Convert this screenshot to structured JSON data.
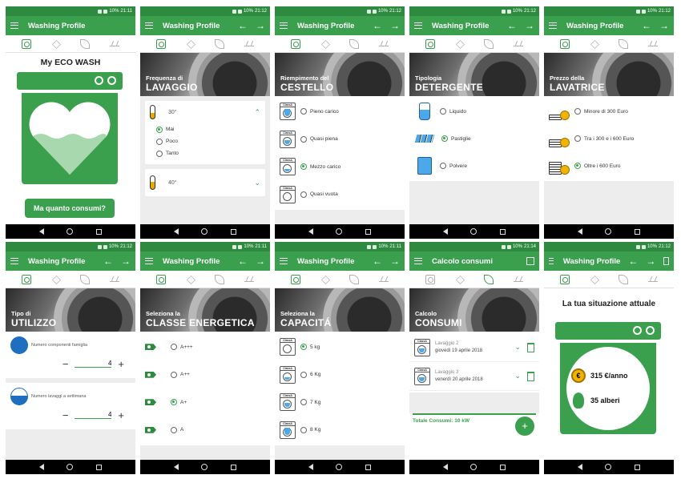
{
  "status_time": [
    "21:11",
    "21:12",
    "21:12",
    "21:12",
    "21:12",
    "21:12",
    "21:11",
    "21:11",
    "21:14",
    "21:12"
  ],
  "status_batt": "10%",
  "app_title": "Washing Profile",
  "screen1": {
    "title": "My ECO WASH",
    "button": "Ma quanto consumi?"
  },
  "screen2": {
    "hero_small": "Frequenza di",
    "hero_big": "LAVAGGIO",
    "temp1": "30°",
    "temp2": "40°",
    "options": [
      "Mai",
      "Poco",
      "Tanto"
    ],
    "selected": 0
  },
  "screen3": {
    "hero_small": "Riempimento del",
    "hero_big": "CESTELLO",
    "options": [
      "Pieno carico",
      "Quasi piena",
      "Mezzo carico",
      "Quasi vuota"
    ],
    "selected": 2
  },
  "screen4": {
    "hero_small": "Tipologia",
    "hero_big": "DETERGENTE",
    "options": [
      "Liquido",
      "Pastiglie",
      "Polvere"
    ],
    "selected": 1
  },
  "screen5": {
    "hero_small": "Prezzo della",
    "hero_big": "LAVATRICE",
    "options": [
      "Minore di 300 Euro",
      "Tra i 300 e i 600 Euro",
      "Oltre i 600 Euro"
    ],
    "selected": 2
  },
  "screen6": {
    "hero_small": "Tipo di",
    "hero_big": "UTILIZZO",
    "field1": "Numero componenti famiglia",
    "value1": "4",
    "field2": "Numero lavaggi a settimana",
    "value2": "4"
  },
  "screen7": {
    "hero_small": "Seleziona la",
    "hero_big": "CLASSE ENERGETICA",
    "options": [
      "A+++",
      "A++",
      "A+",
      "A"
    ],
    "selected": 2
  },
  "screen8": {
    "hero_small": "Seleziona la",
    "hero_big": "CAPACITÁ",
    "options": [
      "5 kg",
      "6 Kg",
      "7 Kg",
      "8 Kg"
    ],
    "selected": 0
  },
  "screen9": {
    "app_title": "Calcolo consumi",
    "hero_small": "Calcolo",
    "hero_big": "CONSUMI",
    "items": [
      {
        "name": "Lavaggio 2",
        "date": "giovedì 19 aprile 2018"
      },
      {
        "name": "Lavaggio 3",
        "date": "venerdì 20 aprile 2018"
      }
    ],
    "total": "Totale Consumi: 10 kW"
  },
  "screen10": {
    "title": "La tua situazione attuale",
    "money": "315 €/anno",
    "trees": "35 alberi"
  },
  "washer_label": "ClassA"
}
